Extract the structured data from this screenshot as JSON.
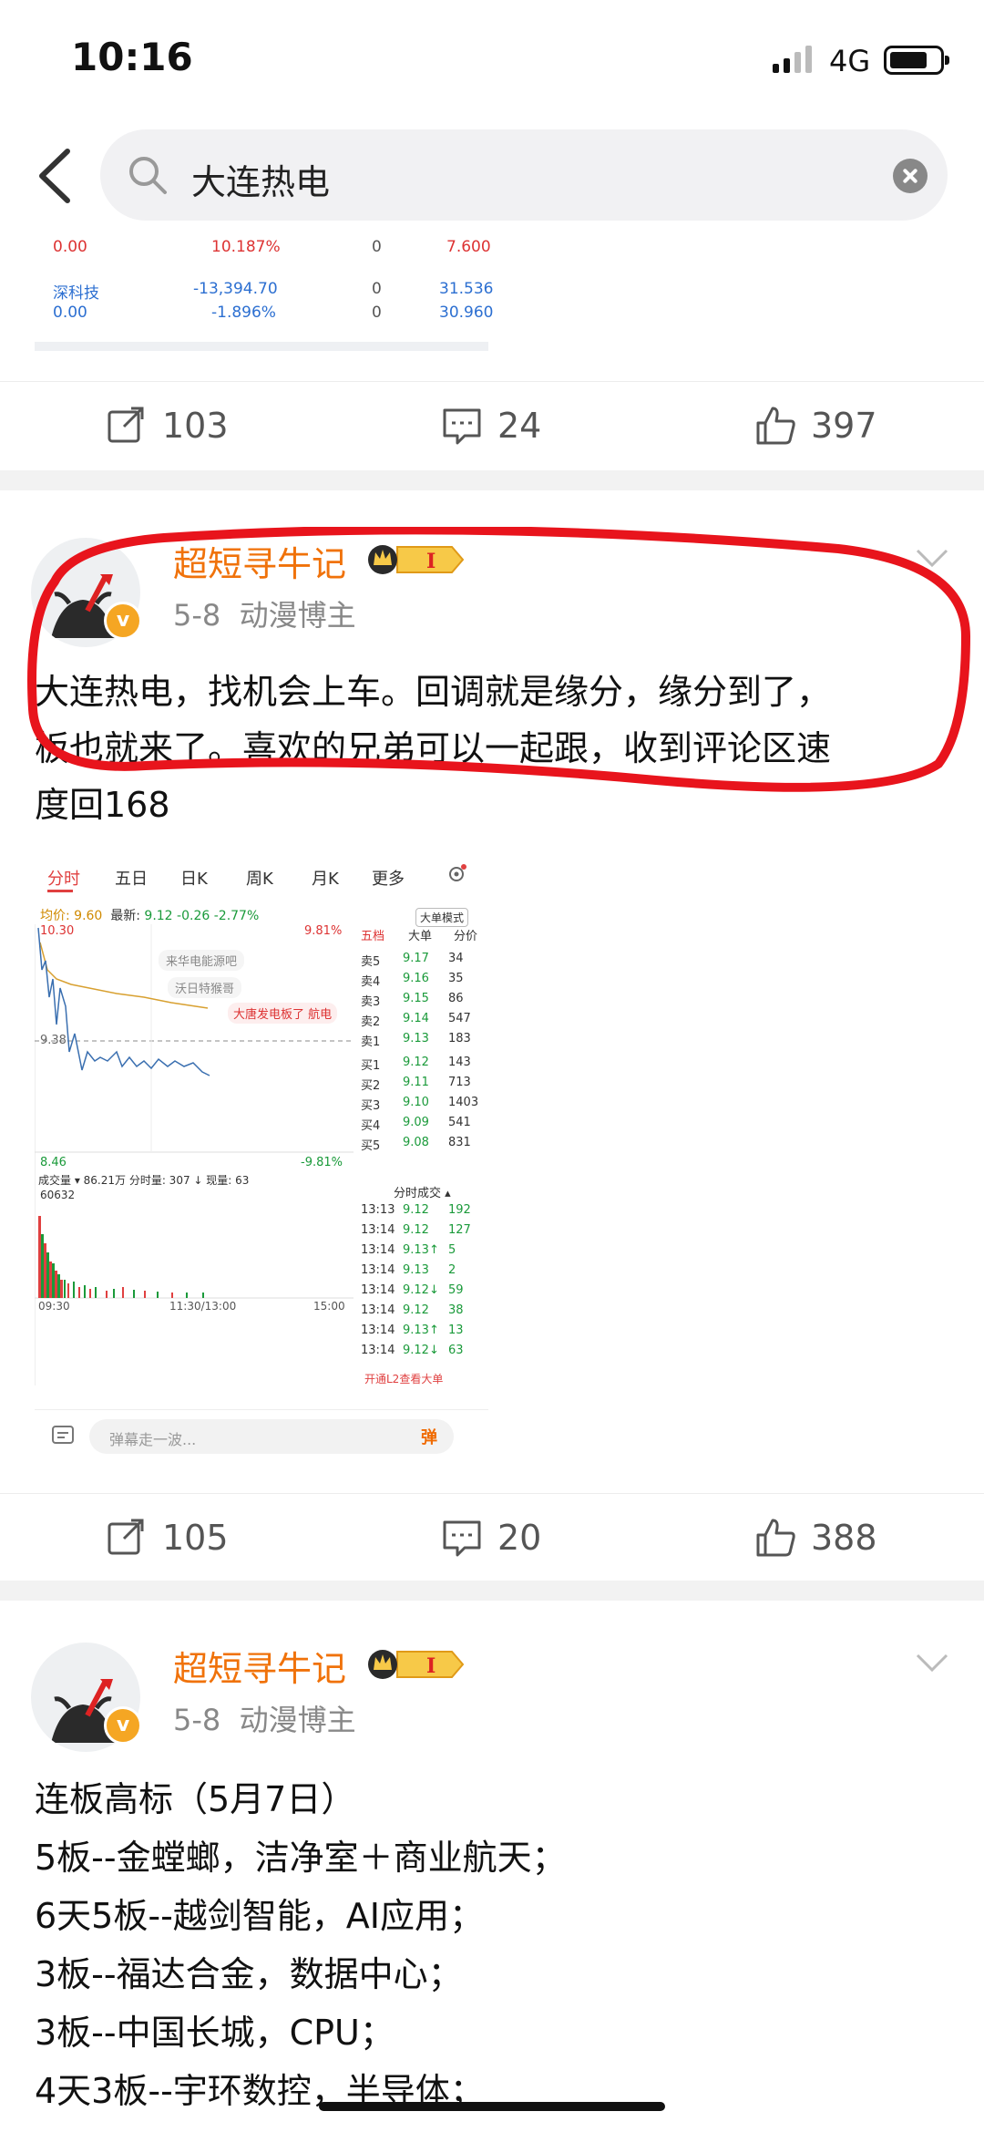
{
  "status_bar": {
    "time": "10:16",
    "network": "4G"
  },
  "search": {
    "query": "大连热电"
  },
  "prev_post": {
    "table_rows": [
      [
        "0.00",
        "10.187%",
        "0",
        "7.600"
      ],
      [
        "深科技",
        "-13,394.70",
        "0",
        "31.536"
      ],
      [
        "0.00",
        "-1.896%",
        "0",
        "30.960"
      ]
    ],
    "repost": "103",
    "comment": "24",
    "like": "397"
  },
  "post1": {
    "username": "超短寻牛记",
    "level": "I",
    "date": "5-8",
    "tag": "动漫博主",
    "text_lines": [
      "大连热电，找机会上车。回调就是缘分，缘分到了，",
      "板也就来了。喜欢的兄弟可以一起跟，收到评论区速",
      "度回168"
    ],
    "stock_shot": {
      "tabs": [
        "分时",
        "五日",
        "日K",
        "周K",
        "月K",
        "更多"
      ],
      "avg_label": "均价:",
      "avg_value": "9.60",
      "latest_label": "最新:",
      "latest_value": "9.12",
      "change": "-0.26",
      "change_pct": "-2.77%",
      "mode_button": "大单模式",
      "high_label": "10.30",
      "high_pct": "9.81%",
      "mid_label": "9.38",
      "low_label": "8.46",
      "low_pct": "-9.81%",
      "danmaku": [
        "来华电能源吧",
        "沃日特猴哥",
        "大唐发电板了 航电"
      ],
      "volume_header": "成交量 ▾ 86.21万 分时量: 307 ↓ 现量: 63",
      "volume_max": "60632",
      "time_labels": [
        "09:30",
        "11:30/13:00",
        "15:00"
      ],
      "ob_header": [
        "五档",
        "大单",
        "分价"
      ],
      "asks": [
        [
          "卖5",
          "9.17",
          "34"
        ],
        [
          "卖4",
          "9.16",
          "35"
        ],
        [
          "卖3",
          "9.15",
          "86"
        ],
        [
          "卖2",
          "9.14",
          "547"
        ],
        [
          "卖1",
          "9.13",
          "183"
        ]
      ],
      "bids": [
        [
          "买1",
          "9.12",
          "143"
        ],
        [
          "买2",
          "9.11",
          "713"
        ],
        [
          "买3",
          "9.10",
          "1403"
        ],
        [
          "买4",
          "9.09",
          "541"
        ],
        [
          "买5",
          "9.08",
          "831"
        ]
      ],
      "ticks_header": "分时成交 ▴",
      "ticks": [
        [
          "13:13",
          "9.12",
          "192"
        ],
        [
          "13:14",
          "9.12",
          "127"
        ],
        [
          "13:14",
          "9.13↑",
          "5"
        ],
        [
          "13:14",
          "9.13",
          "2"
        ],
        [
          "13:14",
          "9.12↓",
          "59"
        ],
        [
          "13:14",
          "9.12",
          "38"
        ],
        [
          "13:14",
          "9.13↑",
          "13"
        ],
        [
          "13:14",
          "9.12↓",
          "63"
        ]
      ],
      "l2_link": "开通L2查看大单",
      "danmaku_placeholder": "弹幕走一波...",
      "danmaku_button": "弹"
    },
    "repost": "105",
    "comment": "20",
    "like": "388"
  },
  "post2": {
    "username": "超短寻牛记",
    "level": "I",
    "date": "5-8",
    "tag": "动漫博主",
    "text_lines": [
      "连板高标（5月7日）",
      "5板--金螳螂，洁净室＋商业航天；",
      "6天5板--越剑智能，AI应用；",
      "3板--福达合金，数据中心；",
      "3板--中国长城，CPU；",
      "4天3板--宇环数控，半导体；"
    ]
  },
  "colors": {
    "accent_orange": "#f0720a",
    "annotation_red": "#e8141c",
    "up_red": "#e04040",
    "down_green": "#1a9a3a"
  }
}
